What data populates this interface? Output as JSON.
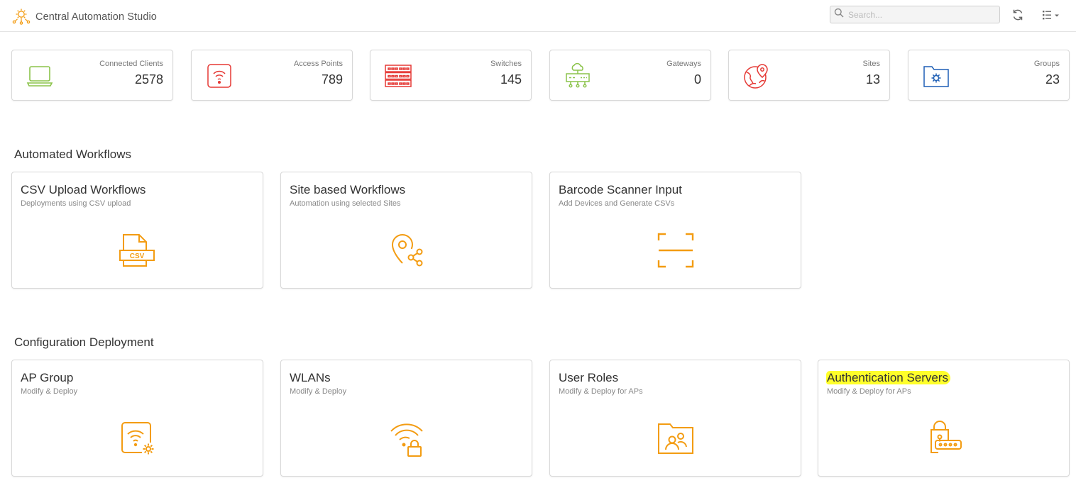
{
  "app": {
    "title": "Central Automation Studio",
    "accent_color": "#f39c12",
    "logo_icon": "gear-network-icon"
  },
  "header": {
    "search_placeholder": "Search...",
    "refresh_icon": "refresh-icon",
    "menu_icon": "list-menu-icon"
  },
  "stats": [
    {
      "label": "Connected Clients",
      "value": "2578",
      "icon": "laptop-icon",
      "color": "#8bc34a"
    },
    {
      "label": "Access Points",
      "value": "789",
      "icon": "access-point-icon",
      "color": "#e53935"
    },
    {
      "label": "Switches",
      "value": "145",
      "icon": "switch-icon",
      "color": "#e53935"
    },
    {
      "label": "Gateways",
      "value": "0",
      "icon": "gateway-icon",
      "color": "#8bc34a"
    },
    {
      "label": "Sites",
      "value": "13",
      "icon": "globe-pin-icon",
      "color": "#e53935"
    },
    {
      "label": "Groups",
      "value": "23",
      "icon": "folder-gear-icon",
      "color": "#1e5fb5"
    }
  ],
  "automated_workflows": {
    "title": "Automated Workflows",
    "cards": [
      {
        "title": "CSV Upload Workflows",
        "subtitle": "Deployments using CSV upload",
        "icon": "csv-file-icon"
      },
      {
        "title": "Site based Workflows",
        "subtitle": "Automation using selected Sites",
        "icon": "location-share-icon"
      },
      {
        "title": "Barcode Scanner Input",
        "subtitle": "Add Devices and Generate CSVs",
        "icon": "barcode-scan-icon"
      }
    ]
  },
  "configuration_deployment": {
    "title": "Configuration Deployment",
    "cards": [
      {
        "title": "AP Group",
        "subtitle": "Modify & Deploy",
        "icon": "ap-gear-icon"
      },
      {
        "title": "WLANs",
        "subtitle": "Modify & Deploy",
        "icon": "wifi-lock-icon"
      },
      {
        "title": "User Roles",
        "subtitle": "Modify & Deploy for APs",
        "icon": "folder-users-icon"
      },
      {
        "title": "Authentication Servers",
        "subtitle": "Modify & Deploy for APs",
        "icon": "server-lock-icon",
        "highlighted": true,
        "highlight_color": "#ffff2a"
      }
    ]
  }
}
